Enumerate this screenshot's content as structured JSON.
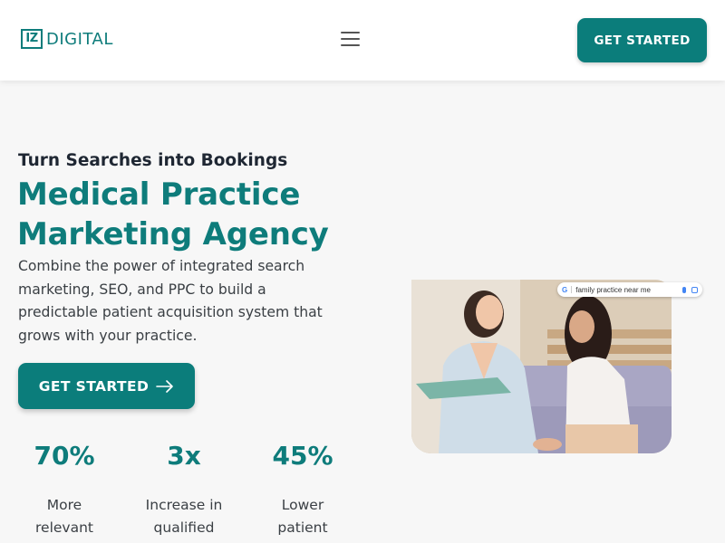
{
  "header": {
    "logo_mark": "IZ",
    "logo_text": "DIGITAL",
    "menu_icon": "hamburger-menu-icon",
    "cta_label": "GET STARTED"
  },
  "hero": {
    "eyebrow": "Turn Searches into Bookings",
    "headline_line1": "Medical Practice",
    "headline_line2": "Marketing Agency",
    "lead_line1": "Combine the power of integrated search",
    "lead_line2": "marketing, SEO, and PPC to build a",
    "lead_line3": "predictable patient acquisition system that",
    "lead_line4": "grows with your practice.",
    "cta_label": "GET STARTED",
    "cta_icon": "arrow-right-icon"
  },
  "stats": [
    {
      "value": "70%",
      "label_line1": "More",
      "label_line2": "relevant"
    },
    {
      "value": "3x",
      "label_line1": "Increase in",
      "label_line2": "qualified"
    },
    {
      "value": "45%",
      "label_line1": "Lower",
      "label_line2": "patient"
    }
  ],
  "image": {
    "search_query": "family practice near me",
    "search_engine_icon": "google-g-icon"
  },
  "colors": {
    "brand": "#0b7d7b",
    "heading_dark": "#1f2733",
    "background": "#f7f7f7"
  }
}
